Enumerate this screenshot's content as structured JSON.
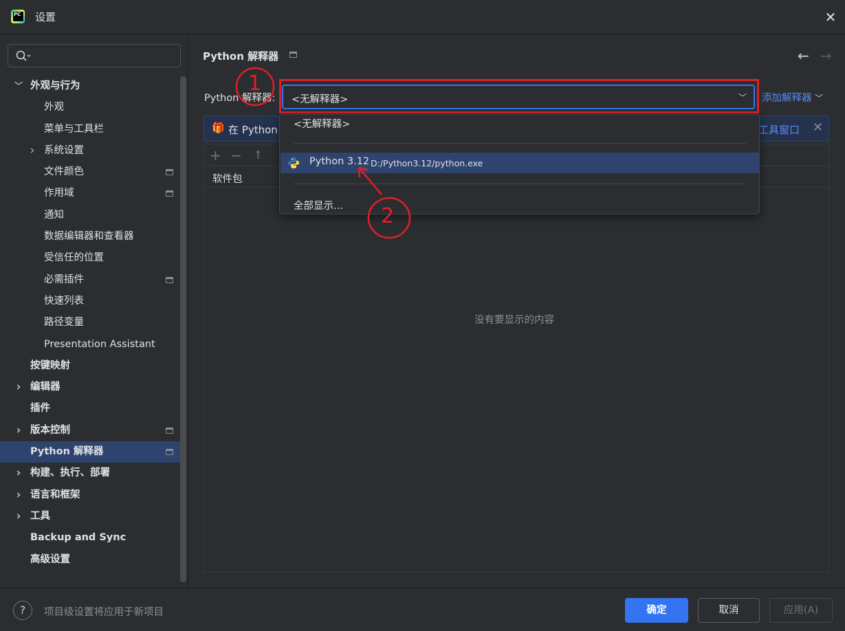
{
  "window": {
    "title": "设置"
  },
  "sidebar": {
    "search_placeholder": "",
    "items": [
      {
        "label": "外观与行为",
        "bold": true,
        "chevron": "expanded"
      },
      {
        "label": "外观"
      },
      {
        "label": "菜单与工具栏"
      },
      {
        "label": "系统设置",
        "chevron": "collapsed"
      },
      {
        "label": "文件颜色",
        "project_icon": true
      },
      {
        "label": "作用域",
        "project_icon": true
      },
      {
        "label": "通知"
      },
      {
        "label": "数据编辑器和查看器"
      },
      {
        "label": "受信任的位置"
      },
      {
        "label": "必需插件",
        "project_icon": true
      },
      {
        "label": "快速列表"
      },
      {
        "label": "路径变量"
      },
      {
        "label": "Presentation Assistant"
      },
      {
        "label": "按键映射",
        "bold": true
      },
      {
        "label": "编辑器",
        "bold": true,
        "chevron": "collapsed"
      },
      {
        "label": "插件",
        "bold": true
      },
      {
        "label": "版本控制",
        "bold": true,
        "chevron": "collapsed",
        "project_icon": true
      },
      {
        "label": "Python 解释器",
        "bold": true,
        "selected": true,
        "project_icon": true
      },
      {
        "label": "构建、执行、部署",
        "bold": true,
        "chevron": "collapsed"
      },
      {
        "label": "语言和框架",
        "bold": true,
        "chevron": "collapsed"
      },
      {
        "label": "工具",
        "bold": true,
        "chevron": "collapsed"
      },
      {
        "label": "Backup and Sync",
        "bold": true
      },
      {
        "label": "高级设置",
        "bold": true
      }
    ]
  },
  "main": {
    "page_title": "Python 解释器",
    "interpreter_label": "Python 解释器:",
    "interpreter_value": "<无解释器>",
    "add_interpreter": "添加解释器",
    "banner_text": "在 Python",
    "banner_link": "工具窗口",
    "packages_header": "软件包",
    "empty_text": "没有要显示的内容"
  },
  "dropdown": {
    "items": [
      {
        "label": "<无解释器>"
      },
      {
        "name": "Python 3.12",
        "path": "D:/Python3.12/python.exe",
        "highlighted": true
      },
      {
        "label": "全部显示..."
      }
    ]
  },
  "annotations": {
    "one": "1",
    "two": "2"
  },
  "footer": {
    "help": "?",
    "hint": "项目级设置将应用于新项目",
    "ok": "确定",
    "cancel": "取消",
    "apply": "应用(A)"
  },
  "colors": {
    "accent": "#3574f0",
    "selection": "#2e436e",
    "link": "#548af7",
    "annotation_red": "#e0202a"
  },
  "icons": [
    "pycharm-app-icon",
    "close-icon",
    "search-icon",
    "chevron-down-icon",
    "chevron-right-icon",
    "project-level-icon",
    "back-arrow-icon",
    "forward-arrow-icon",
    "gift-icon",
    "add-icon",
    "remove-icon",
    "upgrade-icon",
    "python-logo-icon",
    "help-icon"
  ]
}
